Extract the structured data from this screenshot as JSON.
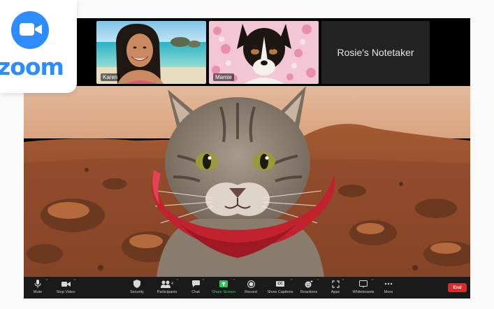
{
  "logo": {
    "wordmark": "zoom",
    "icon": "camera-icon",
    "brand_color": "#2D8CFF"
  },
  "gallery": {
    "tiles": [
      {
        "name": "Karen"
      },
      {
        "name": "Mamie"
      },
      {
        "name": "Rosie's Notetaker"
      }
    ]
  },
  "toolbar": {
    "mute": "Mute",
    "stop_video": "Stop Video",
    "security": "Security",
    "participants": "Participants",
    "participants_count": "4",
    "chat": "Chat",
    "share_screen": "Share Screen",
    "record": "Record",
    "show_captions": "Show Captions",
    "captions_badge": "CC",
    "reactions": "Reactions",
    "apps": "Apps",
    "whiteboards": "Whiteboards",
    "more": "More",
    "end": "End"
  },
  "colors": {
    "end_button": "#E02828",
    "share_screen": "#3BD26E",
    "toolbar_bg": "#1A1A1A"
  }
}
